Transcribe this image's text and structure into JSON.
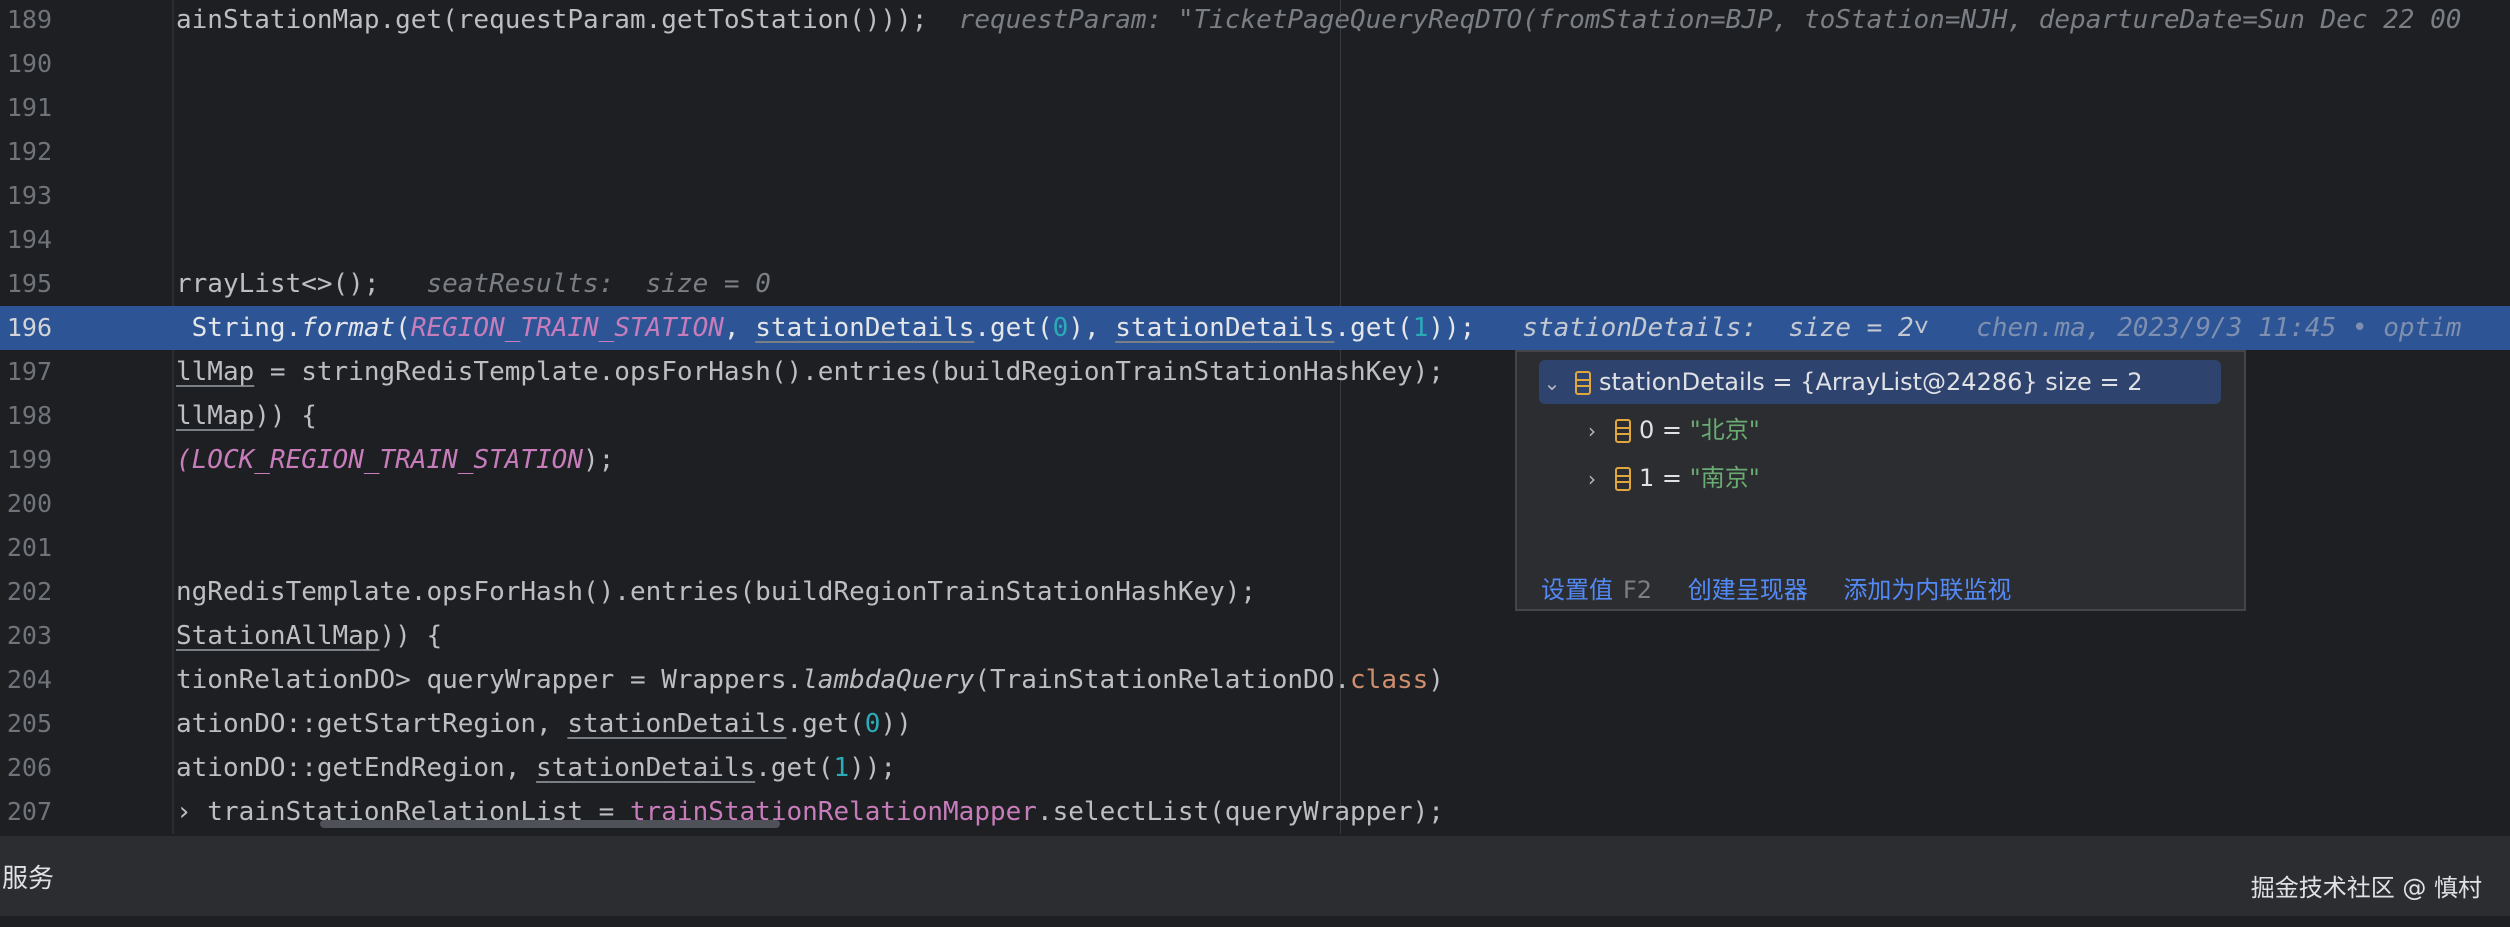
{
  "editor": {
    "lines": [
      {
        "num": "189",
        "parts": [
          {
            "t": "ainStationMap.get(requestParam.getToStation()));"
          },
          {
            "t": "  "
          },
          {
            "t": "requestParam: \"TicketPageQueryReqDTO(fromStation=BJP, toStation=NJH, departureDate=Sun Dec 22 00",
            "c": "hint"
          }
        ]
      },
      {
        "num": "190",
        "parts": []
      },
      {
        "num": "191",
        "parts": []
      },
      {
        "num": "192",
        "parts": []
      },
      {
        "num": "193",
        "parts": []
      },
      {
        "num": "194",
        "parts": []
      },
      {
        "num": "195",
        "parts": [
          {
            "t": "rrayList<>();"
          },
          {
            "t": "   "
          },
          {
            "t": "seatResults:  size = 0",
            "c": "hint"
          }
        ]
      },
      {
        "num": "196",
        "current": true,
        "parts": [
          {
            "t": " String."
          },
          {
            "t": "format",
            "c": "fn"
          },
          {
            "t": "("
          },
          {
            "t": "REGION_TRAIN_STATION",
            "c": "fld"
          },
          {
            "t": ", "
          },
          {
            "t": "stationDetails",
            "c": "u"
          },
          {
            "t": ".get("
          },
          {
            "t": "0",
            "c": "num"
          },
          {
            "t": "), "
          },
          {
            "t": "stationDetails",
            "c": "u"
          },
          {
            "t": ".get("
          },
          {
            "t": "1",
            "c": "num"
          },
          {
            "t": "));"
          },
          {
            "t": "   "
          },
          {
            "t": "stationDetails:  size = 2˅",
            "c": "hint"
          },
          {
            "t": "   "
          },
          {
            "t": "chen.ma, 2023/9/3 11:45 • optim",
            "c": "blame"
          }
        ]
      },
      {
        "num": "197",
        "parts": [
          {
            "t": "llMap",
            "c": "u"
          },
          {
            "t": " = stringRedisTemplate.opsForHash().entries(buildRegionTrainStationHashKey);"
          }
        ]
      },
      {
        "num": "198",
        "parts": [
          {
            "t": "llMap",
            "c": "u"
          },
          {
            "t": ")) {"
          }
        ]
      },
      {
        "num": "199",
        "parts": [
          {
            "t": "(",
            "c": "fld"
          },
          {
            "t": "LOCK_REGION_TRAIN_STATION",
            "c": "fld"
          },
          {
            "t": ");"
          }
        ]
      },
      {
        "num": "200",
        "parts": []
      },
      {
        "num": "201",
        "parts": []
      },
      {
        "num": "202",
        "parts": [
          {
            "t": "ngRedisTemplate.opsForHash().entries(buildRegionTrainStationHashKey);"
          }
        ]
      },
      {
        "num": "203",
        "parts": [
          {
            "t": "StationAllMap",
            "c": "u"
          },
          {
            "t": ")) {"
          }
        ]
      },
      {
        "num": "204",
        "parts": [
          {
            "t": "tionRelationDO> queryWrapper = Wrappers."
          },
          {
            "t": "lambdaQuery",
            "c": "fn"
          },
          {
            "t": "(TrainStationRelationDO."
          },
          {
            "t": "class",
            "c": "k"
          },
          {
            "t": ")"
          }
        ]
      },
      {
        "num": "205",
        "parts": [
          {
            "t": "ationDO::getStartRegion, "
          },
          {
            "t": "stationDetails",
            "c": "u"
          },
          {
            "t": ".get("
          },
          {
            "t": "0",
            "c": "num"
          },
          {
            "t": "))"
          }
        ]
      },
      {
        "num": "206",
        "parts": [
          {
            "t": "ationDO::getEndRegion, "
          },
          {
            "t": "stationDetails",
            "c": "u"
          },
          {
            "t": ".get("
          },
          {
            "t": "1",
            "c": "num"
          },
          {
            "t": "));"
          }
        ]
      },
      {
        "num": "207",
        "parts": [
          {
            "t": "› trainStationRelationList = "
          },
          {
            "t": "trainStationRelationMapper",
            "c": "fld2"
          },
          {
            "t": ".selectList(queryWrapper);"
          }
        ]
      }
    ]
  },
  "popup": {
    "root": {
      "name": "stationDetails",
      "eq": " = ",
      "value": "{ArrayList@24286}",
      "size": "  size = 2"
    },
    "children": [
      {
        "index": "0",
        "eq": " = ",
        "value": "\"北京\""
      },
      {
        "index": "1",
        "eq": " = ",
        "value": "\"南京\""
      }
    ],
    "actions": {
      "set_value": "设置值",
      "set_value_shortcut": "F2",
      "create_renderer": "创建呈现器",
      "add_inline_watch": "添加为内联监视"
    }
  },
  "bottom_panel": {
    "title": "服务",
    "watermark": "掘金技术社区 @ 慎村"
  },
  "colors": {
    "editor_bg": "#1e1f22",
    "current_line": "#2d5595",
    "keyword": "#cf8e6d",
    "number": "#2aacb8",
    "field": "#c77dbb",
    "string": "#6aab73",
    "link": "#548af7"
  }
}
